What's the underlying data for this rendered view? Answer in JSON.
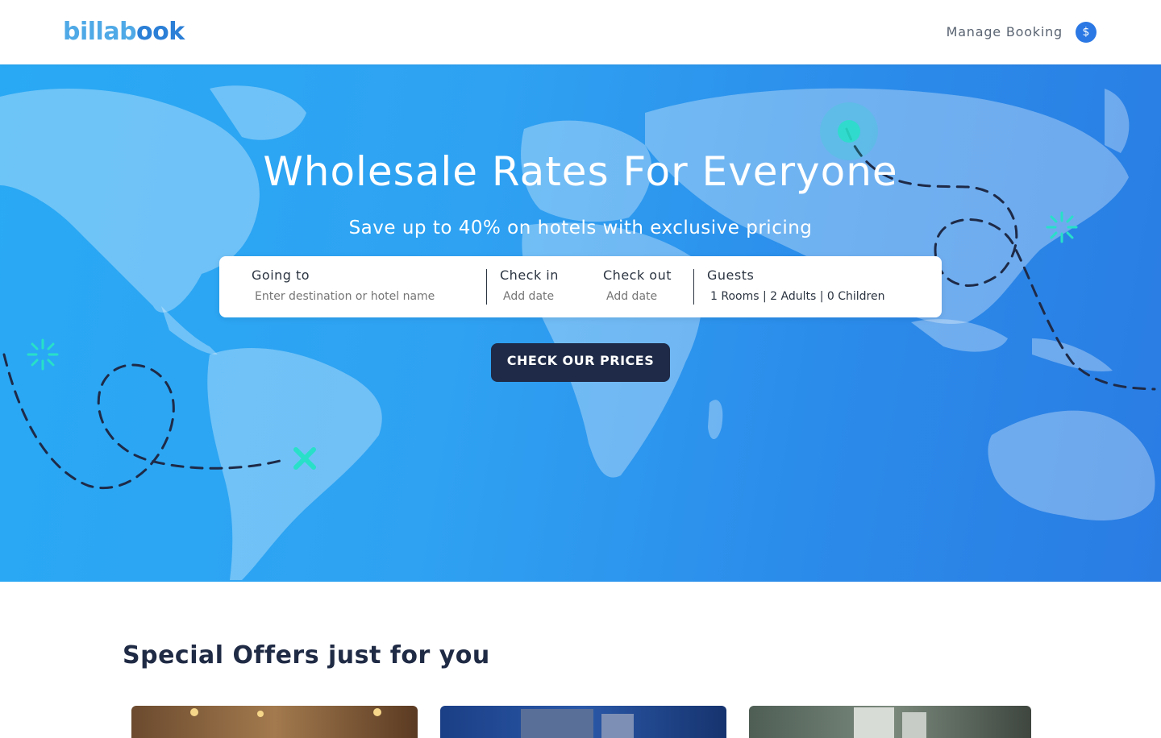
{
  "header": {
    "logo_part1": "billab",
    "logo_part2": "ook",
    "manage_booking": "Manage Booking",
    "currency_symbol": "$"
  },
  "hero": {
    "title": "Wholesale Rates For Everyone",
    "subtitle": "Save up to 40% on hotels with exclusive pricing",
    "search": {
      "destination_label": "Going to",
      "destination_placeholder": "Enter destination or hotel name",
      "checkin_label": "Check in",
      "checkin_placeholder": "Add date",
      "checkout_label": "Check out",
      "checkout_placeholder": "Add date",
      "guests_label": "Guests",
      "guests_value": "1 Rooms | 2 Adults | 0 Children"
    },
    "cta_label": "CHECK OUR PRICES"
  },
  "offers": {
    "title": "Special Offers just for you"
  },
  "colors": {
    "brand_blue": "#2b7fd6",
    "cta_navy": "#1e2a47",
    "accent_teal": "#28e0c8"
  }
}
